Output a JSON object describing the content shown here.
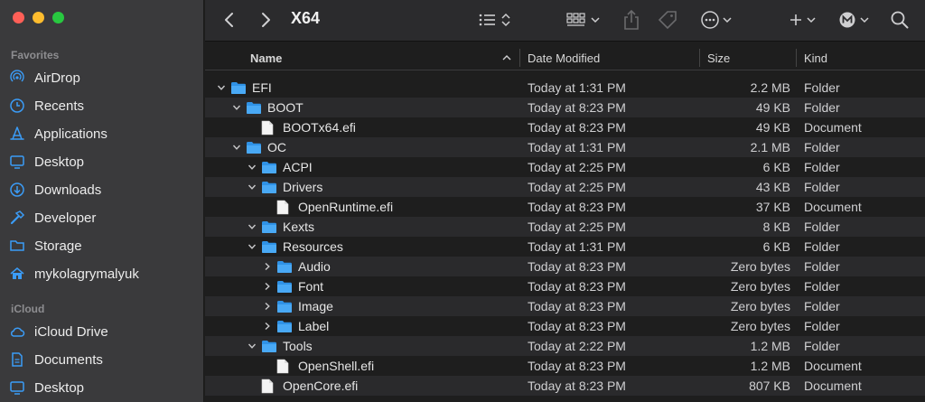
{
  "window": {
    "title": "X64",
    "traffic_lights": {
      "close": "#ff5f57",
      "minimize": "#febc2e",
      "zoom": "#28c840"
    }
  },
  "sidebar": {
    "favorites_title": "Favorites",
    "favorites": [
      {
        "label": "AirDrop",
        "icon": "airdrop-icon"
      },
      {
        "label": "Recents",
        "icon": "clock-icon"
      },
      {
        "label": "Applications",
        "icon": "applications-icon"
      },
      {
        "label": "Desktop",
        "icon": "desktop-icon"
      },
      {
        "label": "Downloads",
        "icon": "download-icon"
      },
      {
        "label": "Developer",
        "icon": "hammer-icon"
      },
      {
        "label": "Storage",
        "icon": "folder-icon"
      },
      {
        "label": "mykolagrymalyuk",
        "icon": "home-icon"
      }
    ],
    "icloud_title": "iCloud",
    "icloud": [
      {
        "label": "iCloud Drive",
        "icon": "cloud-icon"
      },
      {
        "label": "Documents",
        "icon": "document-icon"
      },
      {
        "label": "Desktop",
        "icon": "desktop-icon"
      }
    ],
    "accent": "#3b9cf7"
  },
  "columns": {
    "name": "Name",
    "date": "Date Modified",
    "size": "Size",
    "kind": "Kind"
  },
  "files": [
    {
      "name": "EFI",
      "date": "Today at 1:31 PM",
      "size": "2.2 MB",
      "kind": "Folder",
      "depth": 0,
      "type": "folder",
      "expanded": true
    },
    {
      "name": "BOOT",
      "date": "Today at 8:23 PM",
      "size": "49 KB",
      "kind": "Folder",
      "depth": 1,
      "type": "folder",
      "expanded": true
    },
    {
      "name": "BOOTx64.efi",
      "date": "Today at 8:23 PM",
      "size": "49 KB",
      "kind": "Document",
      "depth": 2,
      "type": "file"
    },
    {
      "name": "OC",
      "date": "Today at 1:31 PM",
      "size": "2.1 MB",
      "kind": "Folder",
      "depth": 1,
      "type": "folder",
      "expanded": true
    },
    {
      "name": "ACPI",
      "date": "Today at 2:25 PM",
      "size": "6 KB",
      "kind": "Folder",
      "depth": 2,
      "type": "folder",
      "expanded": true
    },
    {
      "name": "Drivers",
      "date": "Today at 2:25 PM",
      "size": "43 KB",
      "kind": "Folder",
      "depth": 2,
      "type": "folder",
      "expanded": true
    },
    {
      "name": "OpenRuntime.efi",
      "date": "Today at 8:23 PM",
      "size": "37 KB",
      "kind": "Document",
      "depth": 3,
      "type": "file"
    },
    {
      "name": "Kexts",
      "date": "Today at 2:25 PM",
      "size": "8 KB",
      "kind": "Folder",
      "depth": 2,
      "type": "folder",
      "expanded": true
    },
    {
      "name": "Resources",
      "date": "Today at 1:31 PM",
      "size": "6 KB",
      "kind": "Folder",
      "depth": 2,
      "type": "folder",
      "expanded": true
    },
    {
      "name": "Audio",
      "date": "Today at 8:23 PM",
      "size": "Zero bytes",
      "kind": "Folder",
      "depth": 3,
      "type": "folder",
      "expanded": false
    },
    {
      "name": "Font",
      "date": "Today at 8:23 PM",
      "size": "Zero bytes",
      "kind": "Folder",
      "depth": 3,
      "type": "folder",
      "expanded": false
    },
    {
      "name": "Image",
      "date": "Today at 8:23 PM",
      "size": "Zero bytes",
      "kind": "Folder",
      "depth": 3,
      "type": "folder",
      "expanded": false
    },
    {
      "name": "Label",
      "date": "Today at 8:23 PM",
      "size": "Zero bytes",
      "kind": "Folder",
      "depth": 3,
      "type": "folder",
      "expanded": false
    },
    {
      "name": "Tools",
      "date": "Today at 2:22 PM",
      "size": "1.2 MB",
      "kind": "Folder",
      "depth": 2,
      "type": "folder",
      "expanded": true
    },
    {
      "name": "OpenShell.efi",
      "date": "Today at 8:23 PM",
      "size": "1.2 MB",
      "kind": "Document",
      "depth": 3,
      "type": "file"
    },
    {
      "name": "OpenCore.efi",
      "date": "Today at 8:23 PM",
      "size": "807 KB",
      "kind": "Document",
      "depth": 2,
      "type": "file"
    }
  ]
}
